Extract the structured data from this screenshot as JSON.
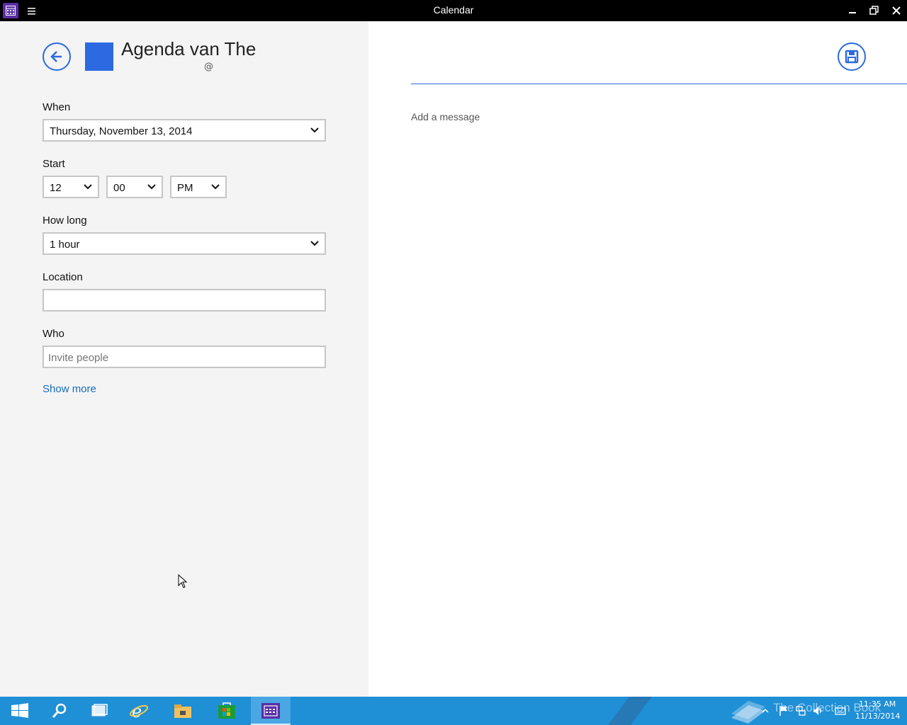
{
  "window": {
    "title": "Calendar",
    "menu_icon": "hamburger-icon",
    "controls": [
      "minimize-icon",
      "restore-icon",
      "close-icon"
    ]
  },
  "event": {
    "calendar_name": "Agenda van The",
    "calendar_account": "@",
    "calendar_color": "#2b6ae0"
  },
  "form": {
    "when_label": "When",
    "when_value": "Thursday, November 13, 2014",
    "start_label": "Start",
    "start_hour": "12",
    "start_minute": "00",
    "start_ampm": "PM",
    "how_long_label": "How long",
    "how_long_value": "1 hour",
    "location_label": "Location",
    "location_value": "",
    "who_label": "Who",
    "who_placeholder": "Invite people",
    "show_more": "Show more"
  },
  "details": {
    "title_value": "",
    "message_placeholder": "Add a message"
  },
  "taskbar": {
    "items": [
      "start-icon",
      "search-icon",
      "task-view-icon",
      "internet-explorer-icon",
      "file-explorer-icon",
      "store-icon",
      "calendar-app-icon"
    ],
    "clock_time": "11:35 AM",
    "clock_date": "11/13/2014",
    "watermark": "The Collection Book",
    "accent": "#1f8fd6"
  }
}
